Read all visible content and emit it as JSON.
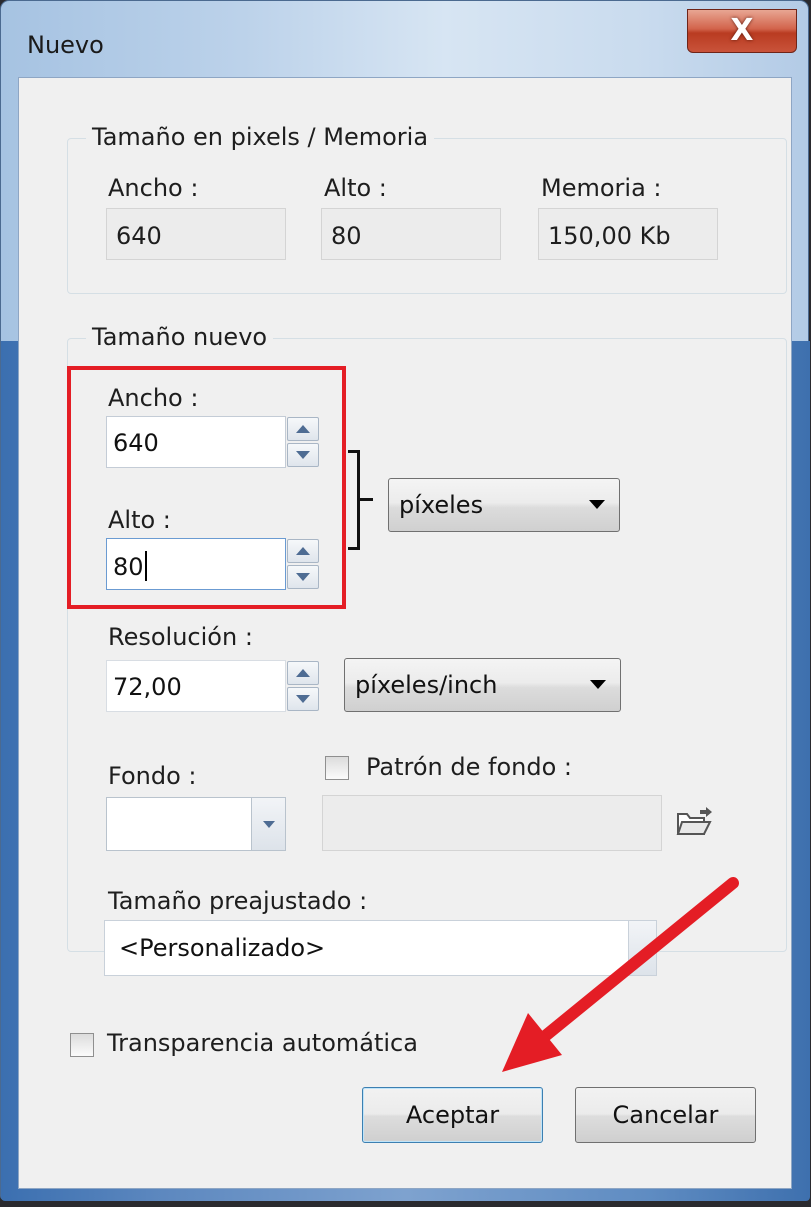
{
  "window": {
    "title": "Nuevo",
    "close_glyph": "X"
  },
  "memory_group": {
    "legend": "Tamaño en pixels / Memoria",
    "width_label": "Ancho :",
    "width_value": "640",
    "height_label": "Alto :",
    "height_value": "80",
    "memory_label": "Memoria :",
    "memory_value": "150,00 Kb"
  },
  "new_size_group": {
    "legend": "Tamaño nuevo",
    "width_label": "Ancho :",
    "width_value": "640",
    "height_label": "Alto :",
    "height_value": "80",
    "unit_selected": "píxeles",
    "resolution_label": "Resolución :",
    "resolution_value": "72,00",
    "resolution_unit_selected": "píxeles/inch",
    "background_label": "Fondo :",
    "pattern_label": "Patrón de fondo :",
    "pattern_checked": false,
    "pattern_value": "",
    "preset_label": "Tamaño preajustado :",
    "preset_value": "<Personalizado>"
  },
  "auto_transparency": {
    "label": "Transparencia automática",
    "checked": false
  },
  "buttons": {
    "accept": "Aceptar",
    "cancel": "Cancelar"
  },
  "colors": {
    "annotation": "#e41d25",
    "close_button": "#c9533a"
  },
  "icons": {
    "open_pattern": "folder-open-icon",
    "arrow": "red-arrow-annotation"
  }
}
